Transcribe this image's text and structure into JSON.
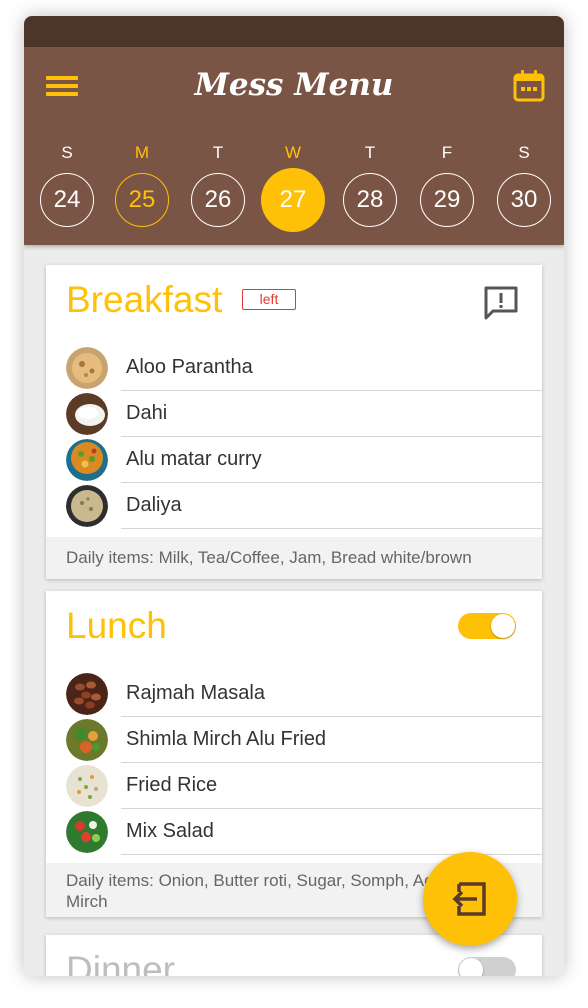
{
  "app": {
    "title": "Mess Menu"
  },
  "colors": {
    "appbar": "#7a5444",
    "statusbar": "#4d352a",
    "accent": "#ffc107",
    "alert": "#e53935"
  },
  "icons": {
    "menu": "hamburger-icon",
    "calendar": "calendar-icon",
    "feedback": "feedback-icon",
    "fab": "exit-to-app-icon"
  },
  "week": [
    {
      "letter": "S",
      "date": "24",
      "state": "normal"
    },
    {
      "letter": "M",
      "date": "25",
      "state": "today"
    },
    {
      "letter": "T",
      "date": "26",
      "state": "normal"
    },
    {
      "letter": "W",
      "date": "27",
      "state": "selected"
    },
    {
      "letter": "T",
      "date": "28",
      "state": "normal"
    },
    {
      "letter": "F",
      "date": "29",
      "state": "normal"
    },
    {
      "letter": "S",
      "date": "30",
      "state": "normal"
    }
  ],
  "breakfast": {
    "title": "Breakfast",
    "badge": "left",
    "items": [
      "Aloo Parantha",
      "Dahi",
      "Alu matar curry",
      "Daliya"
    ],
    "daily": "Daily items: Milk, Tea/Coffee, Jam, Bread white/brown"
  },
  "lunch": {
    "title": "Lunch",
    "toggle_on": true,
    "items": [
      "Rajmah Masala",
      "Shimla Mirch Alu Fried",
      "Fried Rice",
      "Mix Salad"
    ],
    "daily": "Daily items: Onion, Butter roti, Sugar, Somph, Achar, Hari Mirch"
  },
  "dinner": {
    "title": "Dinner",
    "toggle_on": false
  }
}
